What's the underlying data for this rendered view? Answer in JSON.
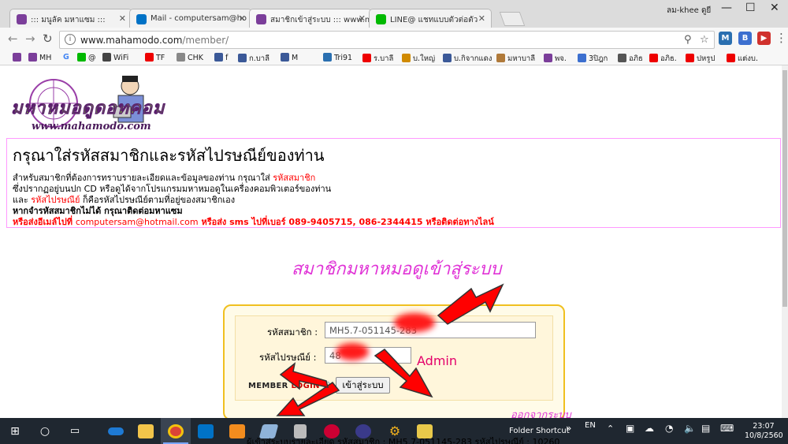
{
  "browser": {
    "tabs": [
      {
        "title": "::: มนูลัค มหาแซม :::",
        "active": false
      },
      {
        "title": "Mail - computersam@ho",
        "active": false
      },
      {
        "title": "สมาชิกเข้าสู่ระบบ ::: www.m",
        "active": true
      },
      {
        "title": "LINE@ แชทแบบตัวต่อตัว",
        "active": false
      }
    ],
    "user": "ลม-khee ดูยี",
    "url_host": "www.mahamodo.com",
    "url_path": "/member/",
    "bookmarks": [
      "MH",
      "G",
      "@",
      "WiFi",
      "TF",
      "CHK",
      "f",
      "ก.บาลี",
      "M",
      "Tri91",
      "ร.บาลี",
      "บ.ใหญ่",
      "บ.กิจากแดง",
      "มหาบาลี",
      "พจ.",
      "3ปิฎก",
      "อภิธ",
      "อภิธ.",
      "ปหรูป",
      "แต่งบ."
    ],
    "extensions": [
      "M",
      "B"
    ]
  },
  "page": {
    "logo_word": "มหาหมอดูดอทคอม",
    "logo_domain": "www.mahamodo.com",
    "heading": "กรุณาใส่รหัสสมาชิกและรหัสไปรษณีย์ของท่าน",
    "line1_prefix": "สำหรับสมาชิกที่ต้องการทราบรายละเอียดและข้อมูลของท่าน กรุณาใส่ ",
    "line1_red": "รหัสสมาชิก",
    "line2": "ซึ่งปรากฏอยู่บนปก CD หรือดูได้จากโปรแกรมมหาหมอดูในเครื่องคอมพิวเตอร์ของท่าน",
    "line3_prefix": "และ ",
    "line3_red": "รหัสไปรษณีย์",
    "line3_suffix": " ก็คือรหัสไปรษณีย์ตามที่อยู่ของสมาชิกเอง",
    "line4": "หากจำรหัสสมาชิกไม่ได้ กรุณาติดต่อมหาแซม",
    "line5_a": "หรือส่งอีเมล์ไปที่ ",
    "line5_email": "computersam@hotmail.com",
    "line5_b": "  หรือส่ง sms ไปที่เบอร์ 089-9405715, 086-2344415  หรือติดต่อทางไลน์",
    "login_heading": "สมาชิกมหาหมอดูเข้าสู่ระบบ",
    "member_id_label": "รหัสสมาชิก :",
    "member_id_value": "MH5.7-051145-283",
    "zip_label": "รหัสไปรษณีย์ :",
    "zip_value": "48",
    "admin_note": "Admin",
    "member_login_a": "MEMBER ",
    "member_login_b": "LOGIN",
    "login_button": "เข้าสู่ระบบ",
    "bottom_heading": "ออกจากระบบ",
    "bottom_text": "ผู้เข้าสู่ระบบรายละเอียด รหัสสมาชิก : MH5.7-051145-283 รหัสไปรษณีย์ : 10260"
  },
  "taskbar": {
    "folder_shortcut": "Folder Shortcut",
    "lang": "EN",
    "time": "23:07",
    "date": "10/8/2560"
  },
  "colors": {
    "accent_magenta": "#e033d6",
    "red": "#ff0000",
    "login_border": "#f0c020"
  }
}
